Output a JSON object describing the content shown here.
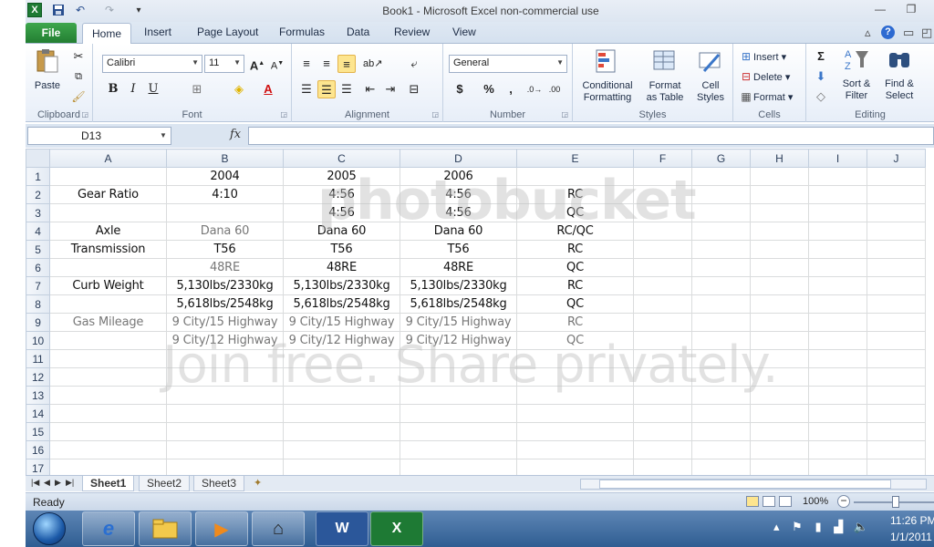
{
  "window": {
    "title": "Book1  -  Microsoft Excel non-commercial use",
    "app_icon": "X",
    "qat": {
      "save": "save-icon",
      "undo": "undo-icon",
      "redo": "redo-icon",
      "customize": "▾"
    }
  },
  "ribbon_tabs": {
    "file": "File",
    "tabs": [
      "Home",
      "Insert",
      "Page Layout",
      "Formulas",
      "Data",
      "Review",
      "View"
    ],
    "help": "?"
  },
  "ribbon": {
    "clipboard": {
      "label": "Clipboard",
      "paste": "Paste"
    },
    "font": {
      "label": "Font",
      "name": "Calibri",
      "size": "11",
      "bold": "B",
      "italic": "I",
      "underline": "U",
      "grow": "A",
      "shrink": "A",
      "font_color_letter": "A"
    },
    "alignment": {
      "label": "Alignment"
    },
    "number": {
      "label": "Number",
      "format": "General",
      "currency": "$",
      "percent": "%",
      "comma": ","
    },
    "styles": {
      "label": "Styles",
      "conditional": [
        "Conditional",
        "Formatting"
      ],
      "format_table": [
        "Format",
        "as Table"
      ],
      "cell_styles": [
        "Cell",
        "Styles"
      ]
    },
    "cells": {
      "label": "Cells",
      "insert": "Insert",
      "delete": "Delete",
      "format": "Format"
    },
    "editing": {
      "label": "Editing",
      "sigma": "Σ",
      "sort_filter": [
        "Sort &",
        "Filter"
      ],
      "find_select": [
        "Find &",
        "Select"
      ]
    }
  },
  "formula_bar": {
    "name_box": "D13",
    "fx": "fx",
    "formula": ""
  },
  "columns": [
    "A",
    "B",
    "C",
    "D",
    "E",
    "F",
    "G",
    "H",
    "I",
    "J"
  ],
  "rows": [
    {
      "n": "1",
      "cells": [
        "",
        "2004",
        "2005",
        "2006",
        "",
        "",
        "",
        "",
        "",
        ""
      ]
    },
    {
      "n": "2",
      "cells": [
        "Gear Ratio",
        "4:10",
        "4:56",
        "4:56",
        "RC",
        "",
        "",
        "",
        "",
        ""
      ]
    },
    {
      "n": "3",
      "cells": [
        "",
        "",
        "4:56",
        "4:56",
        "QC",
        "",
        "",
        "",
        "",
        ""
      ]
    },
    {
      "n": "4",
      "cells": [
        "Axle",
        "Dana 60",
        "Dana 60",
        "Dana 60",
        "RC/QC",
        "",
        "",
        "",
        "",
        ""
      ]
    },
    {
      "n": "5",
      "cells": [
        "Transmission",
        "T56",
        "T56",
        "T56",
        "RC",
        "",
        "",
        "",
        "",
        ""
      ]
    },
    {
      "n": "6",
      "cells": [
        "",
        "48RE",
        "48RE",
        "48RE",
        "QC",
        "",
        "",
        "",
        "",
        ""
      ]
    },
    {
      "n": "7",
      "cells": [
        "Curb Weight",
        "5,130lbs/2330kg",
        "5,130lbs/2330kg",
        "5,130lbs/2330kg",
        "RC",
        "",
        "",
        "",
        "",
        ""
      ]
    },
    {
      "n": "8",
      "cells": [
        "",
        "5,618lbs/2548kg",
        "5,618lbs/2548kg",
        "5,618lbs/2548kg",
        "QC",
        "",
        "",
        "",
        "",
        ""
      ]
    },
    {
      "n": "9",
      "cells": [
        "Gas Mileage",
        "9 City/15 Highway",
        "9 City/15 Highway",
        "9 City/15 Highway",
        "RC",
        "",
        "",
        "",
        "",
        ""
      ]
    },
    {
      "n": "10",
      "cells": [
        "",
        "9 City/12 Highway",
        "9 City/12 Highway",
        "9 City/12 Highway",
        "QC",
        "",
        "",
        "",
        "",
        ""
      ]
    },
    {
      "n": "11",
      "cells": [
        "",
        "",
        "",
        "",
        "",
        "",
        "",
        "",
        "",
        ""
      ]
    },
    {
      "n": "12",
      "cells": [
        "",
        "",
        "",
        "",
        "",
        "",
        "",
        "",
        "",
        ""
      ]
    },
    {
      "n": "13",
      "cells": [
        "",
        "",
        "",
        "",
        "",
        "",
        "",
        "",
        "",
        ""
      ]
    },
    {
      "n": "14",
      "cells": [
        "",
        "",
        "",
        "",
        "",
        "",
        "",
        "",
        "",
        ""
      ]
    },
    {
      "n": "15",
      "cells": [
        "",
        "",
        "",
        "",
        "",
        "",
        "",
        "",
        "",
        ""
      ]
    },
    {
      "n": "16",
      "cells": [
        "",
        "",
        "",
        "",
        "",
        "",
        "",
        "",
        "",
        ""
      ]
    },
    {
      "n": "17",
      "cells": [
        "",
        "",
        "",
        "",
        "",
        "",
        "",
        "",
        "",
        ""
      ]
    }
  ],
  "sheets": [
    "Sheet1",
    "Sheet2",
    "Sheet3"
  ],
  "status": {
    "ready": "Ready",
    "zoom": "100%"
  },
  "taskbar": {
    "time": "11:26 PM",
    "date": "1/1/2011"
  },
  "watermark": {
    "brand": "photobucket",
    "slogan": "Join free. Share privately."
  },
  "colors": {
    "file_tab": "#2e8f3e",
    "selected": "#fde58f",
    "taskbar": "#2f5d92"
  }
}
